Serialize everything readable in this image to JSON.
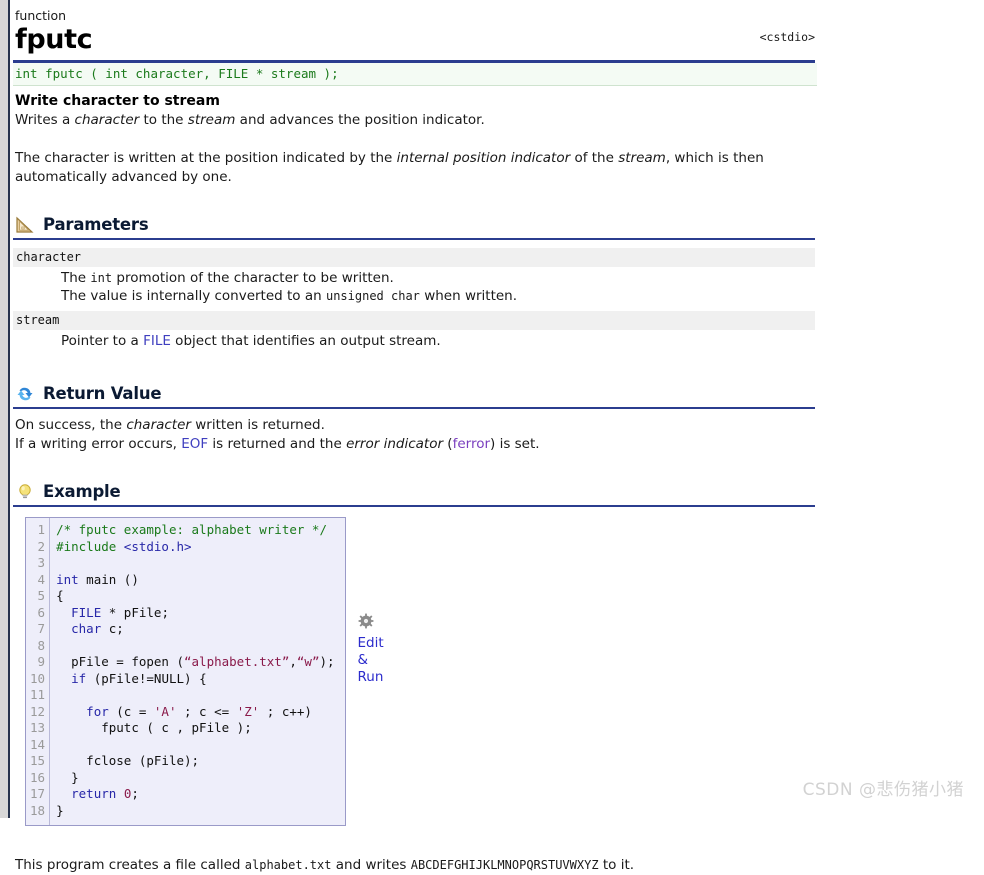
{
  "header": {
    "kind": "function",
    "name": "fputc",
    "include": "<cstdio>",
    "rule_color": "#2b3d8f"
  },
  "prototype": {
    "text": "int fputc ( int character, FILE * stream );",
    "color": "#1b7a1b",
    "background": "#f4fbf4"
  },
  "intro": {
    "subheading": "Write character to stream",
    "p1_a": "Writes a ",
    "p1_b": "character",
    "p1_c": " to the ",
    "p1_d": "stream",
    "p1_e": " and advances the position indicator.",
    "p2_a": "The character is written at the position indicated by the ",
    "p2_b": "internal position indicator",
    "p2_c": " of the ",
    "p2_d": "stream",
    "p2_e": ", which is then automatically advanced by one."
  },
  "parameters": {
    "icon": "triangle-ruler-icon",
    "title": "Parameters",
    "items": [
      {
        "name": "character",
        "desc_line1_a": "The ",
        "desc_line1_code": "int",
        "desc_line1_b": " promotion of the character to be written.",
        "desc_line2_a": "The value is internally converted to an ",
        "desc_line2_code": "unsigned char",
        "desc_line2_b": " when written."
      },
      {
        "name": "stream",
        "desc_line1_a": "Pointer to a ",
        "desc_line1_code": "FILE",
        "desc_line1_b": " object that identifies an output stream.",
        "desc_line2_a": "",
        "desc_line2_code": "",
        "desc_line2_b": ""
      }
    ]
  },
  "return_value": {
    "icon": "return-arrow-icon",
    "title": "Return Value",
    "line1_a": "On success, the ",
    "line1_b": "character",
    "line1_c": " written is returned.",
    "line2_a": "If a writing error occurs, ",
    "line2_eof": "EOF",
    "line2_b": " is returned and the ",
    "line2_c": "error indicator",
    "line2_d": " (",
    "line2_ferror": "ferror",
    "line2_e": ") is set."
  },
  "example": {
    "icon": "lightbulb-icon",
    "title": "Example",
    "line_numbers": "1\n2\n3\n4\n5\n6\n7\n8\n9\n10\n11\n12\n13\n14\n15\n16\n17\n18",
    "code_lines": [
      "/* fputc example: alphabet writer */",
      "#include <stdio.h>",
      "",
      "int main ()",
      "{",
      "  FILE * pFile;",
      "  char c;",
      "",
      "  pFile = fopen (“alphabet.txt”,“w”);",
      "  if (pFile!=NULL) {",
      "",
      "    for (c = 'A' ; c <= 'Z' ; c++)",
      "      fputc ( c , pFile );",
      "",
      "    fclose (pFile);",
      "  }",
      "  return 0;",
      "}"
    ],
    "edit_run": {
      "icon": "gear-icon",
      "line1": "Edit",
      "line2": "&",
      "line3": "Run"
    }
  },
  "outro": {
    "a": "This program creates a file called ",
    "file": "alphabet.txt",
    "b": " and writes ",
    "alphabet": "ABCDEFGHIJKLMNOPQRSTUVWXYZ",
    "c": " to it."
  },
  "watermark": {
    "text": "CSDN @悲伤猪小猪",
    "color": "#d2d2d2"
  }
}
